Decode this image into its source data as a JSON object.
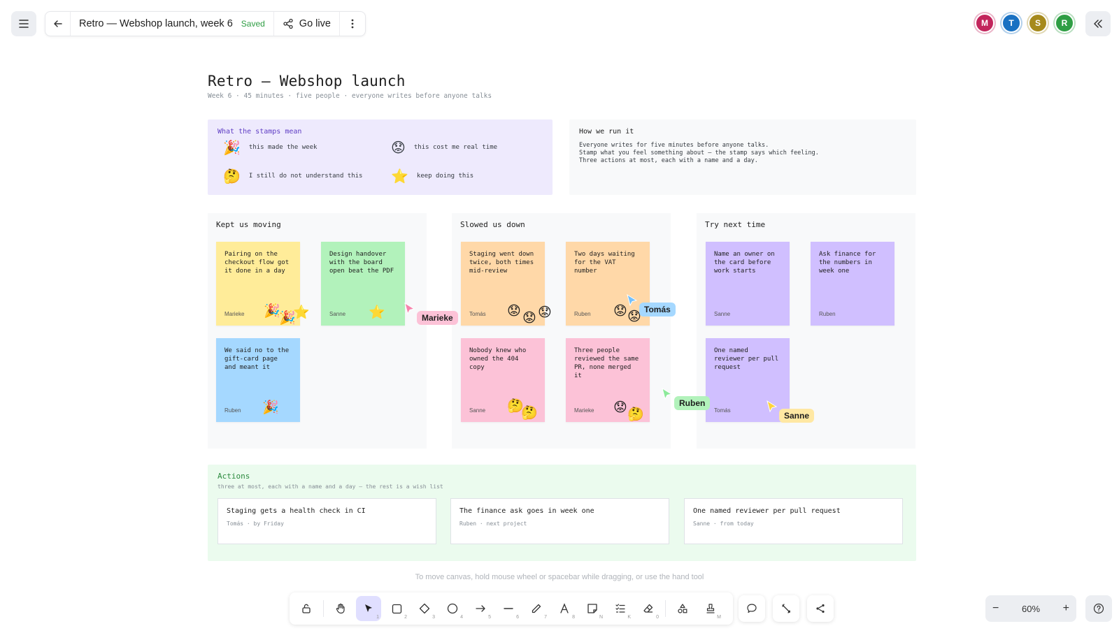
{
  "topbar": {
    "title": "Retro — Webshop launch, week 6",
    "saved": "Saved",
    "go_live": "Go live"
  },
  "avatars": [
    {
      "initial": "M",
      "color": "#c2255c"
    },
    {
      "initial": "T",
      "color": "#1971c2"
    },
    {
      "initial": "S",
      "color": "#a68a1c"
    },
    {
      "initial": "R",
      "color": "#2f9e44"
    }
  ],
  "board": {
    "title": "Retro — Webshop launch",
    "subtitle": "Week 6 · 45 minutes · five people · everyone writes before anyone talks"
  },
  "legend": {
    "heading": "What the stamps mean",
    "items": [
      {
        "icon": "party-popper-icon",
        "glyph": "🎉",
        "label": "this made the week"
      },
      {
        "icon": "worried-face-icon",
        "glyph": "😟",
        "label": "this cost me real time"
      },
      {
        "icon": "thinking-face-icon",
        "glyph": "🤔",
        "label": "I still do not understand this"
      },
      {
        "icon": "star-icon",
        "glyph": "⭐",
        "label": "keep doing this"
      }
    ]
  },
  "howrun": {
    "heading": "How we run it",
    "lines": [
      "Everyone writes for five minutes before anyone talks.",
      "Stamp what you feel something about — the stamp says which feeling.",
      "Three actions at most, each with a name and a day."
    ]
  },
  "columns": [
    {
      "title": "Kept us moving"
    },
    {
      "title": "Slowed us down"
    },
    {
      "title": "Try next time"
    }
  ],
  "notes": [
    {
      "text": "Pairing on the checkout flow got it done in a day",
      "author": "Marieke",
      "color": "#ffec99",
      "stamps": [
        "🎉",
        "🎉",
        "⭐"
      ]
    },
    {
      "text": "Design handover with the board open beat the PDF",
      "author": "Sanne",
      "color": "#b2f2bb",
      "stamps": [
        "⭐"
      ]
    },
    {
      "text": "We said no to the gift-card page and meant it",
      "author": "Ruben",
      "color": "#a5d8ff",
      "stamps": [
        "🎉"
      ]
    },
    {
      "text": "Staging went down twice, both times mid-review",
      "author": "Tomás",
      "color": "#ffd8a8",
      "stamps": [
        "😟",
        "😟",
        "😟"
      ]
    },
    {
      "text": "Two days waiting for the VAT number",
      "author": "Ruben",
      "color": "#ffd8a8",
      "stamps": [
        "😟",
        "😟"
      ]
    },
    {
      "text": "Nobody knew who owned the 404 copy",
      "author": "Sanne",
      "color": "#fcc2d7",
      "stamps": [
        "🤔",
        "🤔"
      ]
    },
    {
      "text": "Three people reviewed the same PR, none merged it",
      "author": "Marieke",
      "color": "#fcc2d7",
      "stamps": [
        "😟",
        "🤔"
      ]
    },
    {
      "text": "Name an owner on the card before work starts",
      "author": "Sanne",
      "color": "#d0bfff",
      "stamps": []
    },
    {
      "text": "Ask finance for the numbers in week one",
      "author": "Ruben",
      "color": "#d0bfff",
      "stamps": []
    },
    {
      "text": "One named reviewer per pull request",
      "author": "Tomás",
      "color": "#d0bfff",
      "stamps": []
    }
  ],
  "cursors": [
    {
      "name": "Marieke",
      "color": "#f783ac",
      "label_bg": "#fcc2d7"
    },
    {
      "name": "Tomás",
      "color": "#74c0fc",
      "label_bg": "#a5d8ff"
    },
    {
      "name": "Ruben",
      "color": "#8ce99a",
      "label_bg": "#b2f2bb"
    },
    {
      "name": "Sanne",
      "color": "#ffd43b",
      "label_bg": "#ffe8a3"
    }
  ],
  "actions": {
    "heading": "Actions",
    "subheading": "three at most, each with a name and a day — the rest is a wish list",
    "cards": [
      {
        "title": "Staging gets a health check in CI",
        "meta": "Tomás · by Friday"
      },
      {
        "title": "The finance ask goes in week one",
        "meta": "Ruben · next project"
      },
      {
        "title": "One named reviewer per pull request",
        "meta": "Sanne · from today"
      }
    ]
  },
  "hint": "To move canvas, hold mouse wheel or spacebar while dragging, or use the hand tool",
  "toolbar": {
    "keys": [
      "1",
      "2",
      "3",
      "4",
      "5",
      "6",
      "7",
      "8",
      "N",
      "K",
      "0",
      "M"
    ]
  },
  "zoom": {
    "level": "60%",
    "minus": "−",
    "plus": "+"
  },
  "colors": {
    "accent": "#6965db",
    "legend_bg": "#eeeafd",
    "actions_bg": "#ebfbee",
    "saved": "#2f9e44"
  }
}
